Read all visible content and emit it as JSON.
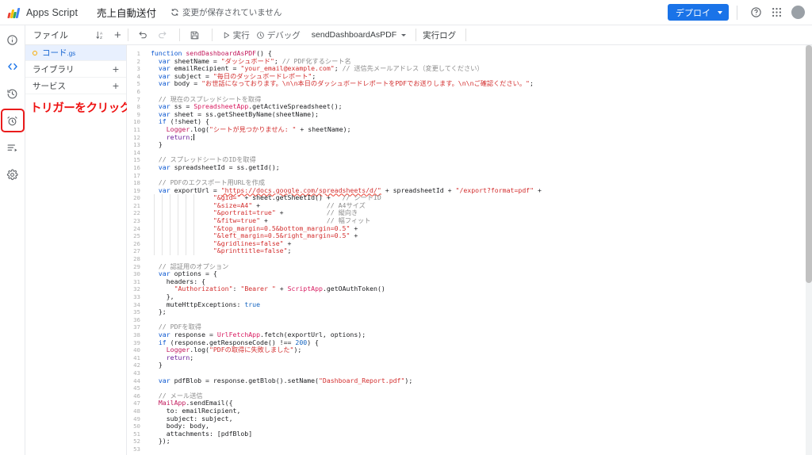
{
  "header": {
    "logo_icon": "apps-script-logo",
    "app_name": "Apps Script",
    "project_title": "売上自動送付",
    "save_status": "変更が保存されていません",
    "save_status_icon": "sync-icon",
    "deploy_label": "デプロイ",
    "deploy_caret_icon": "chevron-down-icon",
    "help_icon": "help-circle-icon",
    "apps_grid_icon": "apps-grid-icon",
    "avatar_icon": "user-avatar",
    "accent_color": "#1a73e8"
  },
  "toolbar": {
    "files_label": "ファイル",
    "sort_icon": "sort-az-icon",
    "add_file_icon": "plus-icon",
    "undo_icon": "undo-icon",
    "redo_icon": "redo-icon",
    "save_icon": "save-project-icon",
    "run_label": "実行",
    "run_icon": "play-icon",
    "debug_label": "デバッグ",
    "debug_icon": "debug-icon",
    "function_selected": "sendDashboardAsPDF",
    "function_caret_icon": "chevron-down-icon",
    "execution_log_label": "実行ログ"
  },
  "rail": {
    "items": [
      {
        "name": "overview",
        "icon": "info-circle-icon",
        "active": false,
        "highlighted": false
      },
      {
        "name": "editor",
        "icon": "code-brackets-icon",
        "active": true,
        "highlighted": false
      },
      {
        "name": "executions-history",
        "icon": "clock-history-icon",
        "active": false,
        "highlighted": false
      },
      {
        "name": "triggers",
        "icon": "alarm-clock-icon",
        "active": false,
        "highlighted": true
      },
      {
        "name": "executions",
        "icon": "list-play-icon",
        "active": false,
        "highlighted": false
      },
      {
        "name": "settings",
        "icon": "gear-icon",
        "active": false,
        "highlighted": false
      }
    ],
    "highlight_color": "#ea1c1c"
  },
  "file_panel": {
    "files": [
      {
        "name": "コード",
        "ext": ".gs",
        "selected": true,
        "status_icon": "file-status-dot"
      }
    ],
    "libraries_label": "ライブラリ",
    "services_label": "サービス",
    "add_icon": "plus-icon",
    "annotation": "トリガーをクリック",
    "annotation_color": "#ee1111"
  },
  "editor": {
    "cursor_line": 12,
    "lines": [
      {
        "n": 1,
        "tokens": [
          {
            "t": "function ",
            "c": "kw"
          },
          {
            "t": "sendDashboardAsPDF",
            "c": "fn"
          },
          {
            "t": "() {",
            "c": ""
          }
        ]
      },
      {
        "n": 2,
        "tokens": [
          {
            "t": "  ",
            "c": ""
          },
          {
            "t": "var ",
            "c": "kw"
          },
          {
            "t": "sheetName = ",
            "c": ""
          },
          {
            "t": "\"ダッシュボード\"",
            "c": "str"
          },
          {
            "t": "; ",
            "c": ""
          },
          {
            "t": "// PDF化するシート名",
            "c": "cmt"
          }
        ]
      },
      {
        "n": 3,
        "tokens": [
          {
            "t": "  ",
            "c": ""
          },
          {
            "t": "var ",
            "c": "kw"
          },
          {
            "t": "emailRecipient = ",
            "c": ""
          },
          {
            "t": "\"your_email@example.com\"",
            "c": "str"
          },
          {
            "t": "; ",
            "c": ""
          },
          {
            "t": "// 送信先メールアドレス（変更してください）",
            "c": "cmt"
          }
        ]
      },
      {
        "n": 4,
        "tokens": [
          {
            "t": "  ",
            "c": ""
          },
          {
            "t": "var ",
            "c": "kw"
          },
          {
            "t": "subject = ",
            "c": ""
          },
          {
            "t": "\"毎日のダッシュボードレポート\"",
            "c": "str"
          },
          {
            "t": ";",
            "c": ""
          }
        ]
      },
      {
        "n": 5,
        "tokens": [
          {
            "t": "  ",
            "c": ""
          },
          {
            "t": "var ",
            "c": "kw"
          },
          {
            "t": "body = ",
            "c": ""
          },
          {
            "t": "\"お世話になっております。\\n\\n本日のダッシュボードレポートをPDFでお送りします。\\n\\nご確認ください。\"",
            "c": "str"
          },
          {
            "t": ";",
            "c": ""
          }
        ]
      },
      {
        "n": 6,
        "tokens": []
      },
      {
        "n": 7,
        "tokens": [
          {
            "t": "  ",
            "c": ""
          },
          {
            "t": "// 現在のスプレッドシートを取得",
            "c": "cmt"
          }
        ]
      },
      {
        "n": 8,
        "tokens": [
          {
            "t": "  ",
            "c": ""
          },
          {
            "t": "var ",
            "c": "kw"
          },
          {
            "t": "ss = ",
            "c": ""
          },
          {
            "t": "SpreadsheetApp",
            "c": "obj"
          },
          {
            "t": ".getActiveSpreadsheet();",
            "c": ""
          }
        ]
      },
      {
        "n": 9,
        "tokens": [
          {
            "t": "  ",
            "c": ""
          },
          {
            "t": "var ",
            "c": "kw"
          },
          {
            "t": "sheet = ss.getSheetByName(sheetName);",
            "c": ""
          }
        ]
      },
      {
        "n": 10,
        "tokens": [
          {
            "t": "  ",
            "c": ""
          },
          {
            "t": "if ",
            "c": "kw"
          },
          {
            "t": "(!sheet) {",
            "c": ""
          }
        ]
      },
      {
        "n": 11,
        "tokens": [
          {
            "t": "    ",
            "c": ""
          },
          {
            "t": "Logger",
            "c": "fn"
          },
          {
            "t": ".log(",
            "c": ""
          },
          {
            "t": "\"シートが見つかりません: \"",
            "c": "str"
          },
          {
            "t": " + sheetName);",
            "c": ""
          }
        ]
      },
      {
        "n": 12,
        "tokens": [
          {
            "t": "    ",
            "c": ""
          },
          {
            "t": "return",
            "c": "kw2"
          },
          {
            "t": ";",
            "c": ""
          }
        ]
      },
      {
        "n": 13,
        "tokens": [
          {
            "t": "  }",
            "c": ""
          }
        ]
      },
      {
        "n": 14,
        "tokens": []
      },
      {
        "n": 15,
        "tokens": [
          {
            "t": "  ",
            "c": ""
          },
          {
            "t": "// スプレッドシートのIDを取得",
            "c": "cmt"
          }
        ]
      },
      {
        "n": 16,
        "tokens": [
          {
            "t": "  ",
            "c": ""
          },
          {
            "t": "var ",
            "c": "kw"
          },
          {
            "t": "spreadsheetId = ss.",
            "c": ""
          },
          {
            "t": "getId",
            "c": ""
          },
          {
            "t": "();",
            "c": ""
          }
        ]
      },
      {
        "n": 17,
        "tokens": []
      },
      {
        "n": 18,
        "tokens": [
          {
            "t": "  ",
            "c": ""
          },
          {
            "t": "// PDFのエクスポート用URLを作成",
            "c": "cmt"
          }
        ]
      },
      {
        "n": 19,
        "tokens": [
          {
            "t": "  ",
            "c": ""
          },
          {
            "t": "var ",
            "c": "kw"
          },
          {
            "t": "exportUrl = ",
            "c": ""
          },
          {
            "t": "\"https://docs.google.com/spreadsheets/d/\"",
            "c": "url"
          },
          {
            "t": " + spreadsheetId + ",
            "c": ""
          },
          {
            "t": "\"/export?format=pdf\"",
            "c": "str"
          },
          {
            "t": " +",
            "c": ""
          }
        ]
      },
      {
        "n": 20,
        "tokens": [
          {
            "t": "                ",
            "c": ""
          },
          {
            "t": "\"&gid=\"",
            "c": "str"
          },
          {
            "t": " + sheet.getSheetId() +   ",
            "c": ""
          },
          {
            "t": "// シートID",
            "c": "cmt"
          }
        ]
      },
      {
        "n": 21,
        "tokens": [
          {
            "t": "                ",
            "c": ""
          },
          {
            "t": "\"&size=A4\"",
            "c": "str"
          },
          {
            "t": " +                 ",
            "c": ""
          },
          {
            "t": "// A4サイズ",
            "c": "cmt"
          }
        ]
      },
      {
        "n": 22,
        "tokens": [
          {
            "t": "                ",
            "c": ""
          },
          {
            "t": "\"&portrait=true\"",
            "c": "str"
          },
          {
            "t": " +           ",
            "c": ""
          },
          {
            "t": "// 縦向き",
            "c": "cmt"
          }
        ]
      },
      {
        "n": 23,
        "tokens": [
          {
            "t": "                ",
            "c": ""
          },
          {
            "t": "\"&fitw=true\"",
            "c": "str"
          },
          {
            "t": " +               ",
            "c": ""
          },
          {
            "t": "// 幅フィット",
            "c": "cmt"
          }
        ]
      },
      {
        "n": 24,
        "tokens": [
          {
            "t": "                ",
            "c": ""
          },
          {
            "t": "\"&top_margin=0.5&bottom_margin=0.5\"",
            "c": "str"
          },
          {
            "t": " +",
            "c": ""
          }
        ]
      },
      {
        "n": 25,
        "tokens": [
          {
            "t": "                ",
            "c": ""
          },
          {
            "t": "\"&left_margin=0.5&right_margin=0.5\"",
            "c": "str"
          },
          {
            "t": " +",
            "c": ""
          }
        ]
      },
      {
        "n": 26,
        "tokens": [
          {
            "t": "                ",
            "c": ""
          },
          {
            "t": "\"&gridlines=false\"",
            "c": "str"
          },
          {
            "t": " +",
            "c": ""
          }
        ]
      },
      {
        "n": 27,
        "tokens": [
          {
            "t": "                ",
            "c": ""
          },
          {
            "t": "\"&printtitle=false\"",
            "c": "str"
          },
          {
            "t": ";",
            "c": ""
          }
        ]
      },
      {
        "n": 28,
        "tokens": []
      },
      {
        "n": 29,
        "tokens": [
          {
            "t": "  ",
            "c": ""
          },
          {
            "t": "// 認証用のオプション",
            "c": "cmt"
          }
        ]
      },
      {
        "n": 30,
        "tokens": [
          {
            "t": "  ",
            "c": ""
          },
          {
            "t": "var ",
            "c": "kw"
          },
          {
            "t": "options = {",
            "c": ""
          }
        ]
      },
      {
        "n": 31,
        "tokens": [
          {
            "t": "    headers: {",
            "c": ""
          }
        ]
      },
      {
        "n": 32,
        "tokens": [
          {
            "t": "      ",
            "c": ""
          },
          {
            "t": "\"Authorization\"",
            "c": "str"
          },
          {
            "t": ": ",
            "c": ""
          },
          {
            "t": "\"Bearer \"",
            "c": "str"
          },
          {
            "t": " + ",
            "c": ""
          },
          {
            "t": "ScriptApp",
            "c": "obj"
          },
          {
            "t": ".getOAuthToken()",
            "c": ""
          }
        ]
      },
      {
        "n": 33,
        "tokens": [
          {
            "t": "    },",
            "c": ""
          }
        ]
      },
      {
        "n": 34,
        "tokens": [
          {
            "t": "    muteHttpExceptions: ",
            "c": ""
          },
          {
            "t": "true",
            "c": "bool"
          }
        ]
      },
      {
        "n": 35,
        "tokens": [
          {
            "t": "  };",
            "c": ""
          }
        ]
      },
      {
        "n": 36,
        "tokens": []
      },
      {
        "n": 37,
        "tokens": [
          {
            "t": "  ",
            "c": ""
          },
          {
            "t": "// PDFを取得",
            "c": "cmt"
          }
        ]
      },
      {
        "n": 38,
        "tokens": [
          {
            "t": "  ",
            "c": ""
          },
          {
            "t": "var ",
            "c": "kw"
          },
          {
            "t": "response = ",
            "c": ""
          },
          {
            "t": "UrlFetchApp",
            "c": "obj"
          },
          {
            "t": ".fetch(exportUrl, options);",
            "c": ""
          }
        ]
      },
      {
        "n": 39,
        "tokens": [
          {
            "t": "  ",
            "c": ""
          },
          {
            "t": "if ",
            "c": "kw"
          },
          {
            "t": "(response.getResponseCode() !== ",
            "c": ""
          },
          {
            "t": "200",
            "c": "num"
          },
          {
            "t": ") {",
            "c": ""
          }
        ]
      },
      {
        "n": 40,
        "tokens": [
          {
            "t": "    ",
            "c": ""
          },
          {
            "t": "Logger",
            "c": "fn"
          },
          {
            "t": ".log(",
            "c": ""
          },
          {
            "t": "\"PDFの取得に失敗しました\"",
            "c": "str"
          },
          {
            "t": ");",
            "c": ""
          }
        ]
      },
      {
        "n": 41,
        "tokens": [
          {
            "t": "    ",
            "c": ""
          },
          {
            "t": "return",
            "c": "kw2"
          },
          {
            "t": ";",
            "c": ""
          }
        ]
      },
      {
        "n": 42,
        "tokens": [
          {
            "t": "  }",
            "c": ""
          }
        ]
      },
      {
        "n": 43,
        "tokens": []
      },
      {
        "n": 44,
        "tokens": [
          {
            "t": "  ",
            "c": ""
          },
          {
            "t": "var ",
            "c": "kw"
          },
          {
            "t": "pdfBlob = response.getBlob().setName(",
            "c": ""
          },
          {
            "t": "\"Dashboard_Report.pdf\"",
            "c": "str"
          },
          {
            "t": ");",
            "c": ""
          }
        ]
      },
      {
        "n": 45,
        "tokens": []
      },
      {
        "n": 46,
        "tokens": [
          {
            "t": "  ",
            "c": ""
          },
          {
            "t": "// メール送信",
            "c": "cmt"
          }
        ]
      },
      {
        "n": 47,
        "tokens": [
          {
            "t": "  ",
            "c": ""
          },
          {
            "t": "MailApp",
            "c": "fn"
          },
          {
            "t": ".sendEmail({",
            "c": ""
          }
        ]
      },
      {
        "n": 48,
        "tokens": [
          {
            "t": "    to: emailRecipient,",
            "c": ""
          }
        ]
      },
      {
        "n": 49,
        "tokens": [
          {
            "t": "    subject: subject,",
            "c": ""
          }
        ]
      },
      {
        "n": 50,
        "tokens": [
          {
            "t": "    body: body,",
            "c": ""
          }
        ]
      },
      {
        "n": 51,
        "tokens": [
          {
            "t": "    attachments: [pdfBlob]",
            "c": ""
          }
        ]
      },
      {
        "n": 52,
        "tokens": [
          {
            "t": "  });",
            "c": ""
          }
        ]
      },
      {
        "n": 53,
        "tokens": []
      }
    ]
  }
}
